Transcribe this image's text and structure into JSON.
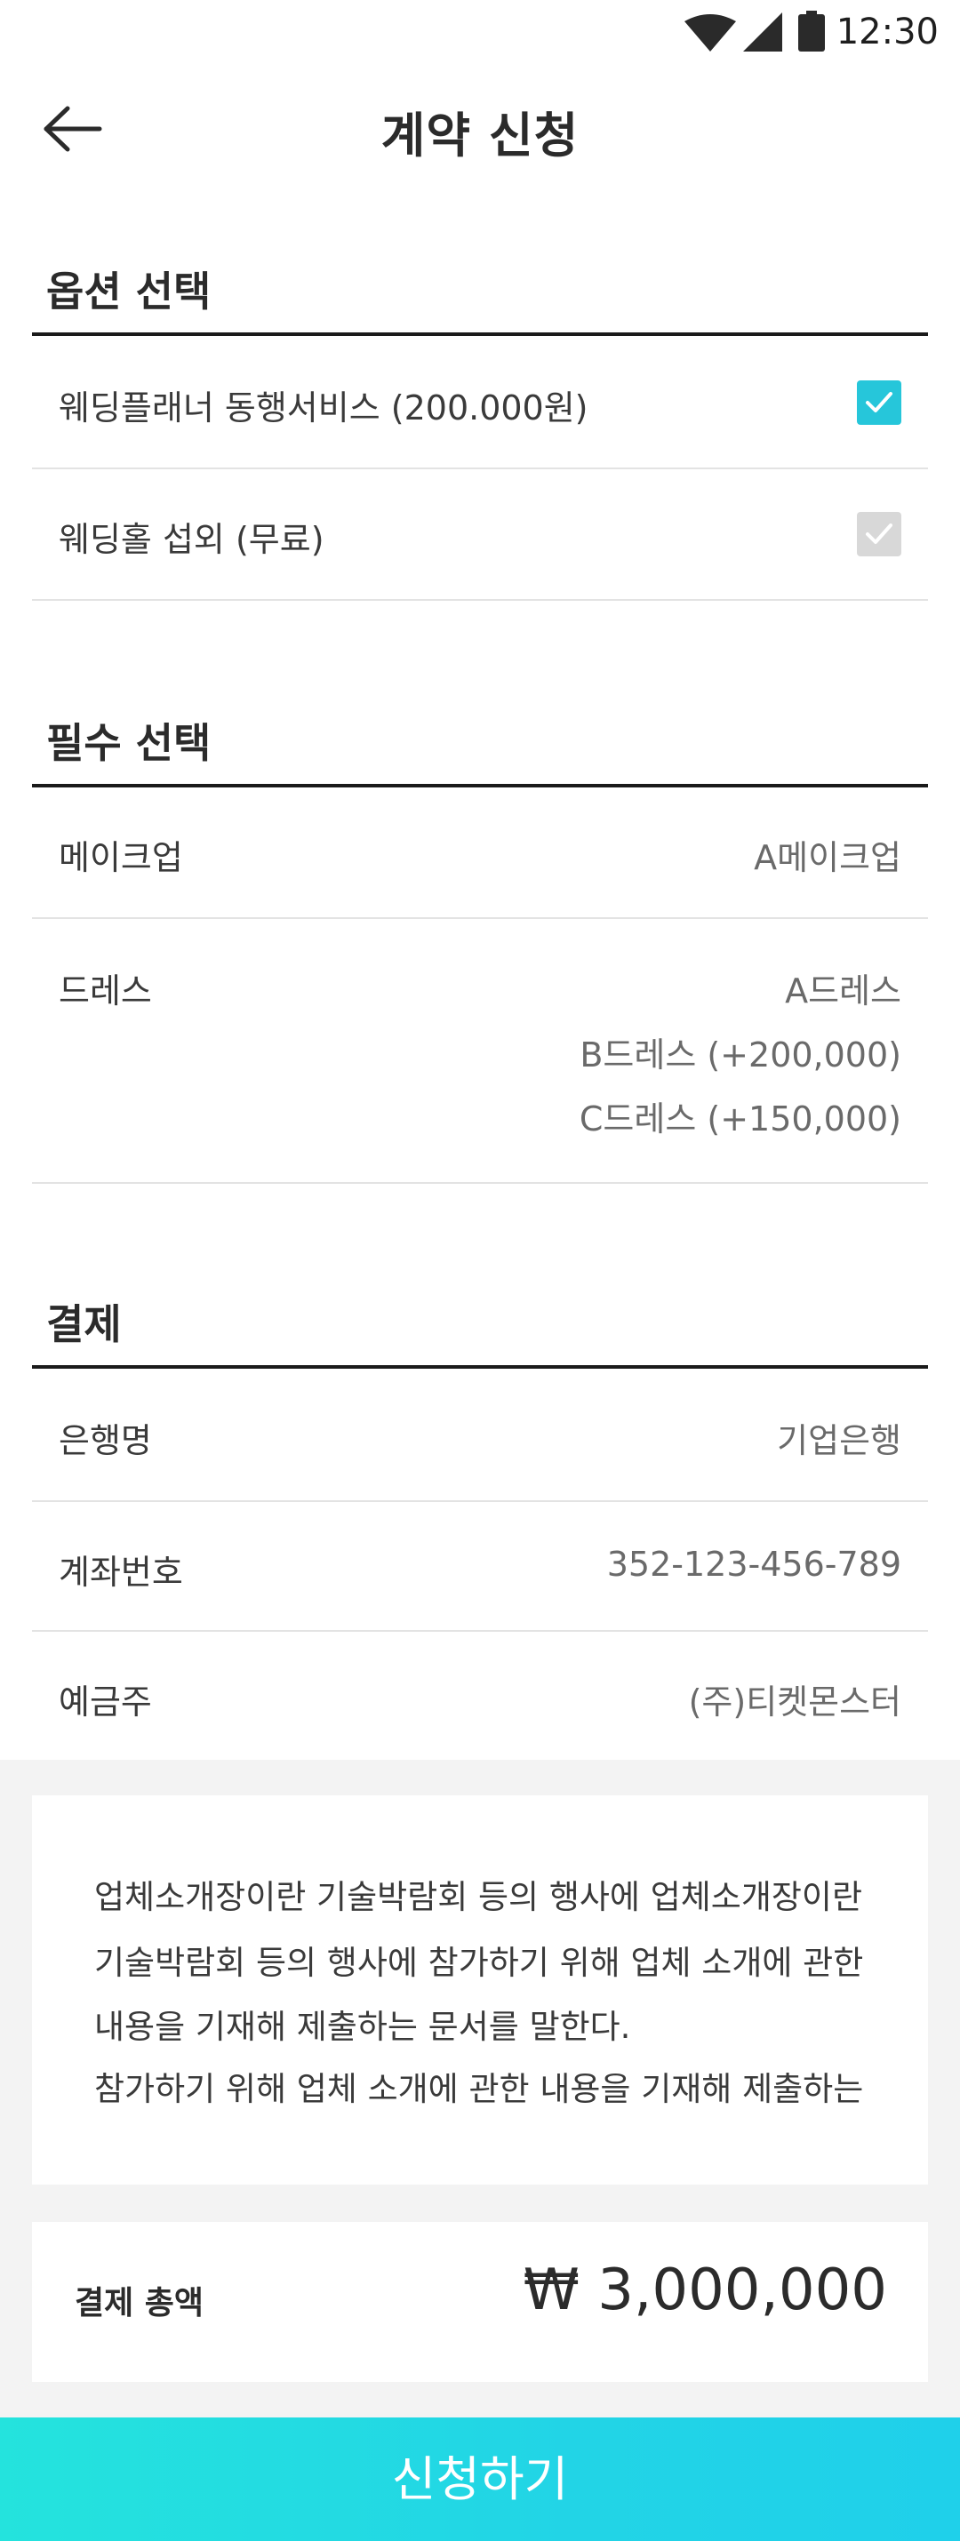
{
  "status_bar": {
    "time": "12:30"
  },
  "header": {
    "title": "계약 신청",
    "back_icon": "arrow-left-icon"
  },
  "options": {
    "title": "옵션 선택",
    "items": [
      {
        "label": "웨딩플래너 동행서비스 (200.000원)",
        "checked": true,
        "checkbox_color": "#26c6da"
      },
      {
        "label": "웨딩홀 섭외 (무료)",
        "checked": true,
        "disabled": true,
        "checkbox_color": "#d8d8d8"
      }
    ]
  },
  "required": {
    "title": "필수 선택",
    "rows": [
      {
        "label": "메이크업",
        "values": [
          "A메이크업"
        ]
      },
      {
        "label": "드레스",
        "values": [
          "A드레스",
          "B드레스 (+200,000)",
          "C드레스 (+150,000)"
        ]
      }
    ]
  },
  "payment": {
    "title": "결제",
    "rows": [
      {
        "label": "은행명",
        "value": "기업은행"
      },
      {
        "label": "계좌번호",
        "value": "352-123-456-789"
      },
      {
        "label": "예금주",
        "value": "(주)티켓몬스터"
      }
    ]
  },
  "notice": {
    "lines": [
      "업체소개장이란 기술박람회 등의 행사에 업체소개장이란",
      "기술박람회 등의 행사에 참가하기 위해 업체 소개에 관한",
      "내용을 기재해 제출하는 문서를 말한다.",
      "참가하기 위해 업체 소개에 관한 내용을 기재해 제출하는"
    ]
  },
  "total": {
    "label": "결제 총액",
    "amount": "₩ 3,000,000"
  },
  "submit": {
    "label": "신청하기",
    "accent_color": "#22d4e6"
  }
}
